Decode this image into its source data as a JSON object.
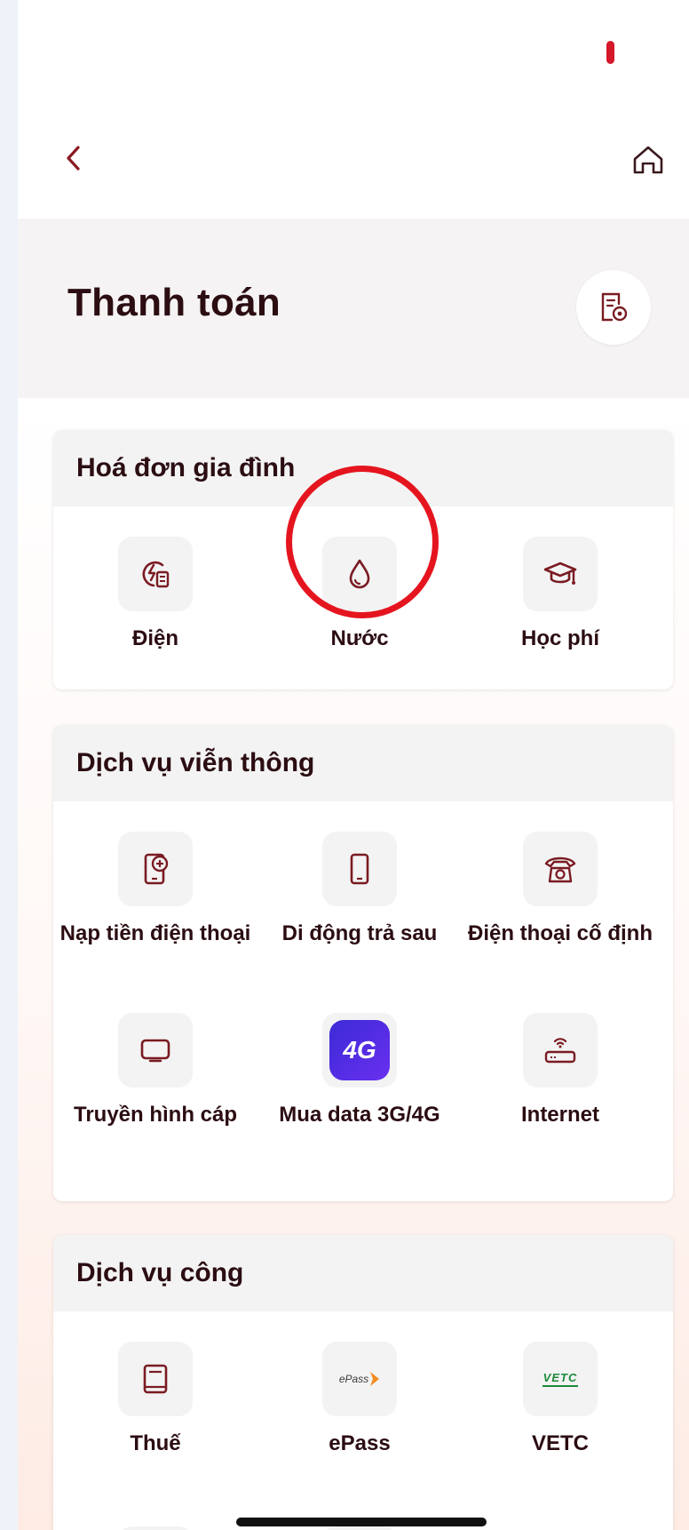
{
  "header": {
    "title": "Thanh toán"
  },
  "sections": [
    {
      "title": "Hoá đơn gia đình",
      "items": [
        {
          "label": "Điện",
          "icon": "electricity-bill-icon"
        },
        {
          "label": "Nước",
          "icon": "water-drop-icon"
        },
        {
          "label": "Học phí",
          "icon": "graduation-cap-icon"
        }
      ]
    },
    {
      "title": "Dịch vụ viễn thông",
      "items": [
        {
          "label": "Nạp tiền điện thoại",
          "icon": "phone-topup-icon"
        },
        {
          "label": "Di động trả sau",
          "icon": "mobile-phone-icon"
        },
        {
          "label": "Điện thoại cố định",
          "icon": "landline-phone-icon"
        },
        {
          "label": "Truyền hình cáp",
          "icon": "tv-icon"
        },
        {
          "label": "Mua data 3G/4G",
          "icon": "4g-icon",
          "badge": "4G"
        },
        {
          "label": "Internet",
          "icon": "router-icon"
        }
      ]
    },
    {
      "title": "Dịch vụ công",
      "items": [
        {
          "label": "Thuế",
          "icon": "tax-book-icon"
        },
        {
          "label": "ePass",
          "icon": "epass-logo-icon",
          "logo_text": "ePass"
        },
        {
          "label": "VETC",
          "icon": "vetc-logo-icon",
          "logo_text": "VETC"
        }
      ]
    }
  ],
  "colors": {
    "accent": "#7a1b22",
    "highlight": "#e5151f",
    "text": "#2b0d12"
  }
}
